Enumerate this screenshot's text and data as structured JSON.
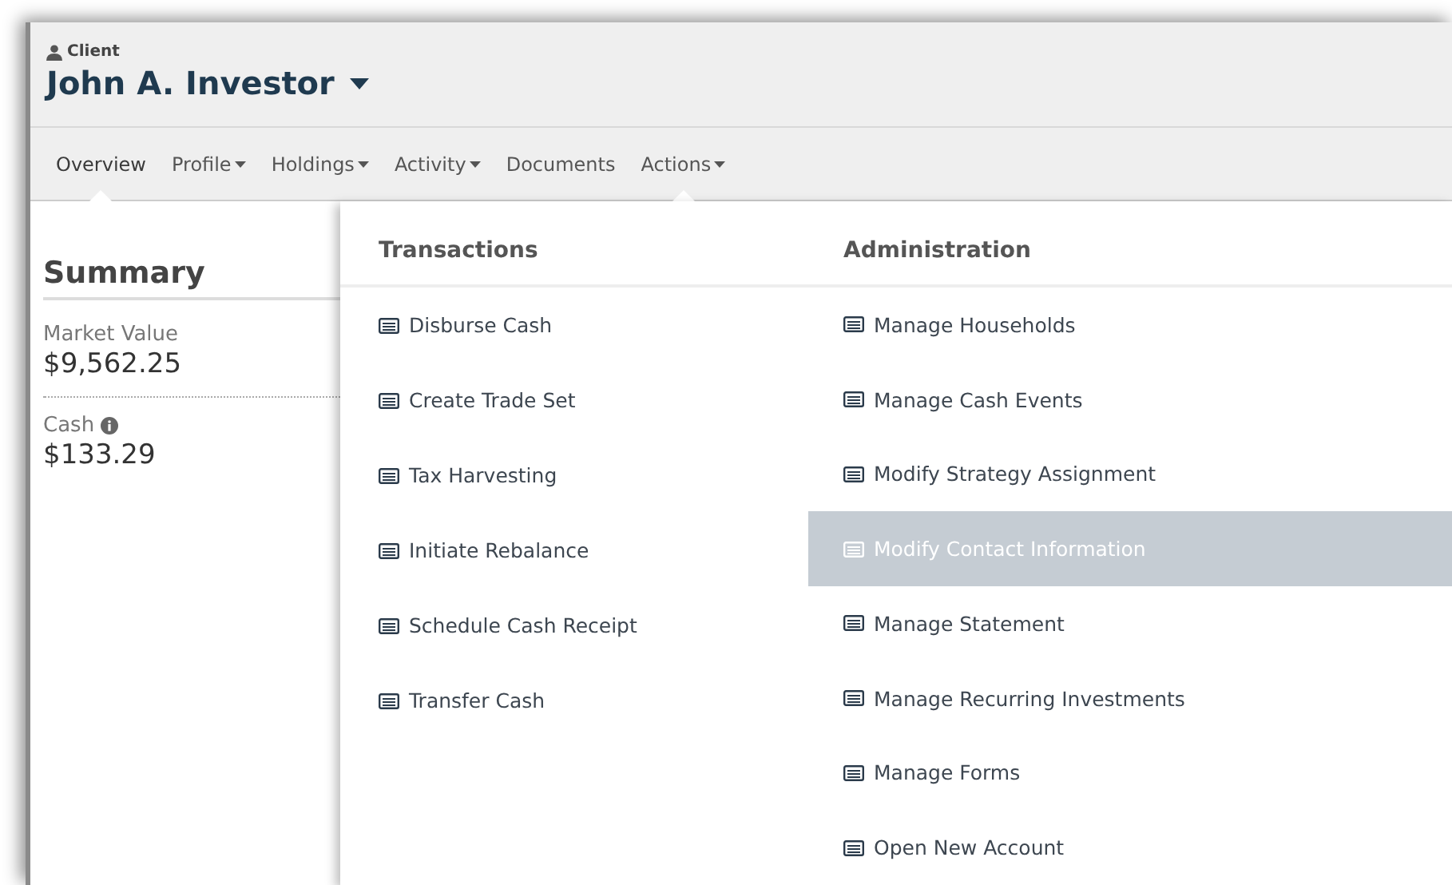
{
  "client": {
    "label": "Client",
    "name": "John A. Investor"
  },
  "tabs": [
    {
      "label": "Overview",
      "selected": true,
      "has_menu": false,
      "open": false
    },
    {
      "label": "Profile",
      "selected": false,
      "has_menu": true,
      "open": false
    },
    {
      "label": "Holdings",
      "selected": false,
      "has_menu": true,
      "open": false
    },
    {
      "label": "Activity",
      "selected": false,
      "has_menu": true,
      "open": false
    },
    {
      "label": "Documents",
      "selected": false,
      "has_menu": false,
      "open": false
    },
    {
      "label": "Actions",
      "selected": false,
      "has_menu": true,
      "open": true
    }
  ],
  "summary": {
    "title": "Summary",
    "items": [
      {
        "label": "Market Value",
        "value": "$9,562.25",
        "info": false
      },
      {
        "label": "Cash",
        "value": "$133.29",
        "info": true
      }
    ]
  },
  "actions_menu": {
    "columns": [
      {
        "title": "Transactions",
        "items": [
          {
            "label": "Disburse Cash",
            "selected": false
          },
          {
            "label": "Create Trade Set",
            "selected": false
          },
          {
            "label": "Tax Harvesting",
            "selected": false
          },
          {
            "label": "Initiate Rebalance",
            "selected": false
          },
          {
            "label": "Schedule Cash Receipt",
            "selected": false
          },
          {
            "label": "Transfer Cash",
            "selected": false
          }
        ]
      },
      {
        "title": "Administration",
        "items": [
          {
            "label": "Manage Households",
            "selected": false
          },
          {
            "label": "Manage Cash Events",
            "selected": false
          },
          {
            "label": "Modify Strategy Assignment",
            "selected": false
          },
          {
            "label": "Modify Contact Information",
            "selected": true
          },
          {
            "label": "Manage Statement",
            "selected": false
          },
          {
            "label": "Manage Recurring Investments",
            "selected": false
          },
          {
            "label": "Manage Forms",
            "selected": false
          },
          {
            "label": "Open New Account",
            "selected": false
          }
        ]
      }
    ]
  }
}
